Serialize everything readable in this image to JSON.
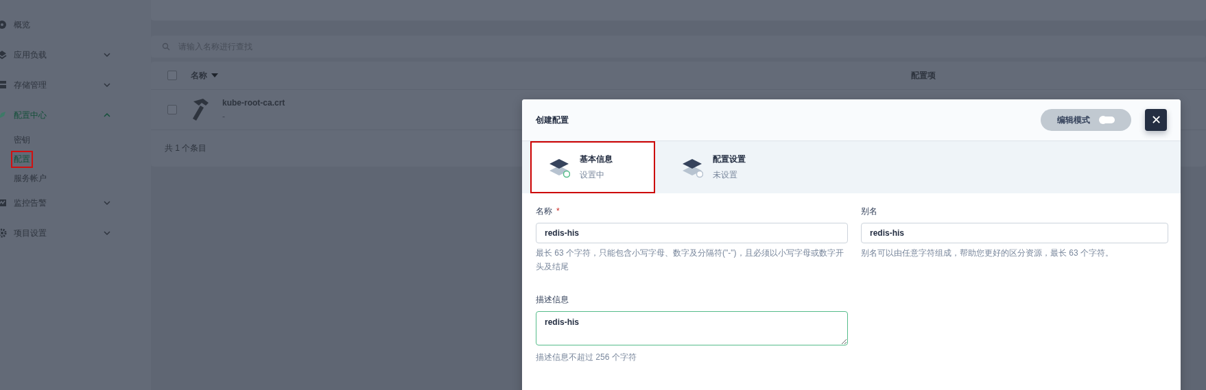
{
  "sidebar": {
    "items": [
      {
        "label": "概览",
        "selected": false
      },
      {
        "label": "应用负载",
        "expanded": false,
        "selected": false
      },
      {
        "label": "存储管理",
        "expanded": false,
        "selected": false
      },
      {
        "label": "配置中心",
        "expanded": true,
        "selected": true,
        "children": [
          {
            "label": "密钥",
            "selected": false,
            "highlighted": false
          },
          {
            "label": "配置",
            "selected": true,
            "highlighted": true
          },
          {
            "label": "服务帐户",
            "selected": false,
            "highlighted": false
          }
        ]
      },
      {
        "label": "监控告警",
        "expanded": false,
        "selected": false
      },
      {
        "label": "项目设置",
        "expanded": false,
        "selected": false
      }
    ]
  },
  "search": {
    "placeholder": "请输入名称进行查找"
  },
  "table": {
    "select_all_checked": false,
    "columns": [
      {
        "label": "名称",
        "sortable": true
      },
      {
        "label": "配置项"
      }
    ],
    "rows": [
      {
        "name": "kube-root-ca.crt",
        "subtitle": "-",
        "checked": false
      }
    ],
    "footer": "共 1 个条目"
  },
  "dialog": {
    "title": "创建配置",
    "edit_mode": {
      "label": "编辑模式",
      "on": false
    },
    "close": "✕",
    "steps": [
      {
        "title": "基本信息",
        "status": "设置中",
        "selected": true,
        "done": false,
        "highlighted": true
      },
      {
        "title": "配置设置",
        "status": "未设置",
        "selected": false,
        "done": false,
        "highlighted": false
      }
    ],
    "fields": {
      "name": {
        "label": "名称",
        "required_mark": "*",
        "value": "redis-his",
        "hint": "最长 63 个字符，只能包含小写字母、数字及分隔符(\"-\")，且必须以小写字母或数字开头及结尾"
      },
      "alias": {
        "label": "别名",
        "value": "redis-his",
        "hint": "别名可以由任意字符组成，帮助您更好的区分资源，最长 63 个字符。"
      },
      "description": {
        "label": "描述信息",
        "value": "redis-his",
        "focused": true,
        "hint": "描述信息不超过 256 个字符"
      }
    }
  }
}
